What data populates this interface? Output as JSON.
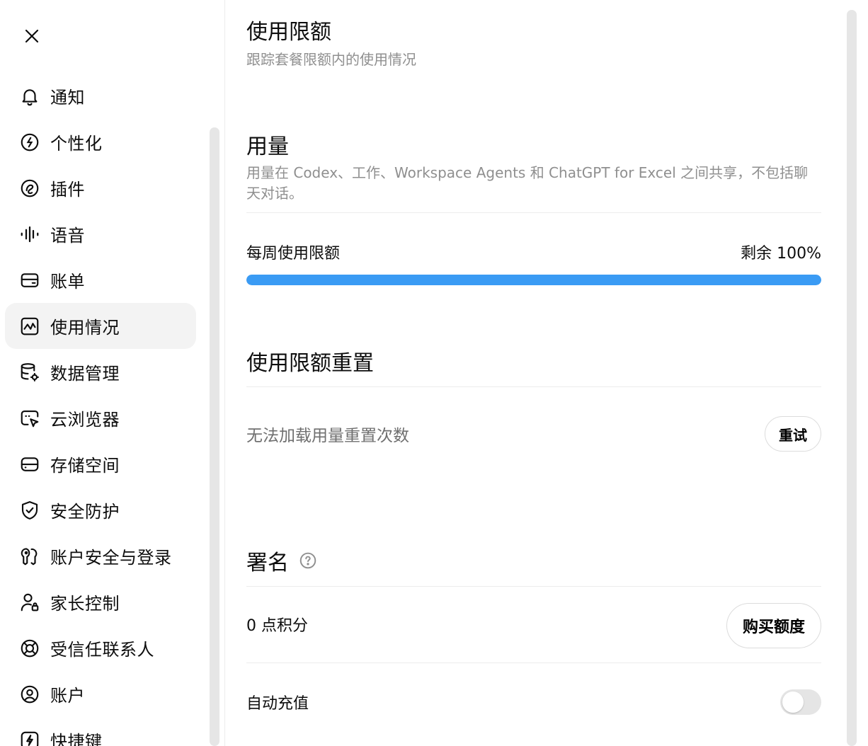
{
  "sidebar": {
    "items": [
      {
        "label": "通知",
        "icon": "bell-icon"
      },
      {
        "label": "个性化",
        "icon": "personalize-icon"
      },
      {
        "label": "插件",
        "icon": "plugin-icon"
      },
      {
        "label": "语音",
        "icon": "voice-wave-icon"
      },
      {
        "label": "账单",
        "icon": "card-icon"
      },
      {
        "label": "使用情况",
        "icon": "chart-icon",
        "active": true
      },
      {
        "label": "数据管理",
        "icon": "database-gear-icon"
      },
      {
        "label": "云浏览器",
        "icon": "cloud-browser-icon"
      },
      {
        "label": "存储空间",
        "icon": "storage-icon"
      },
      {
        "label": "安全防护",
        "icon": "shield-check-icon"
      },
      {
        "label": "账户安全与登录",
        "icon": "key-icon"
      },
      {
        "label": "家长控制",
        "icon": "parent-lock-icon"
      },
      {
        "label": "受信任联系人",
        "icon": "lifebuoy-icon"
      },
      {
        "label": "账户",
        "icon": "user-circle-icon"
      },
      {
        "label": "快捷键",
        "icon": "lightning-icon"
      }
    ]
  },
  "main": {
    "title": "使用限额",
    "subtitle": "跟踪套餐限额内的使用情况",
    "usage": {
      "title": "用量",
      "description": "用量在 Codex、工作、Workspace Agents 和 ChatGPT for Excel 之间共享，不包括聊天对话。",
      "weekly_label": "每周使用限额",
      "weekly_value": "剩余 100%",
      "progress_percent": 100
    },
    "reset": {
      "title": "使用限额重置",
      "message": "无法加载用量重置次数",
      "retry_label": "重试"
    },
    "signature": {
      "title": "署名",
      "credits": "0 点积分",
      "buy_label": "购买额度",
      "auto_recharge_label": "自动充值",
      "auto_recharge_on": false
    }
  },
  "colors": {
    "accent": "#3a9bf4",
    "active_bg": "#f3f3f3",
    "muted_text": "#8f8f8f"
  }
}
